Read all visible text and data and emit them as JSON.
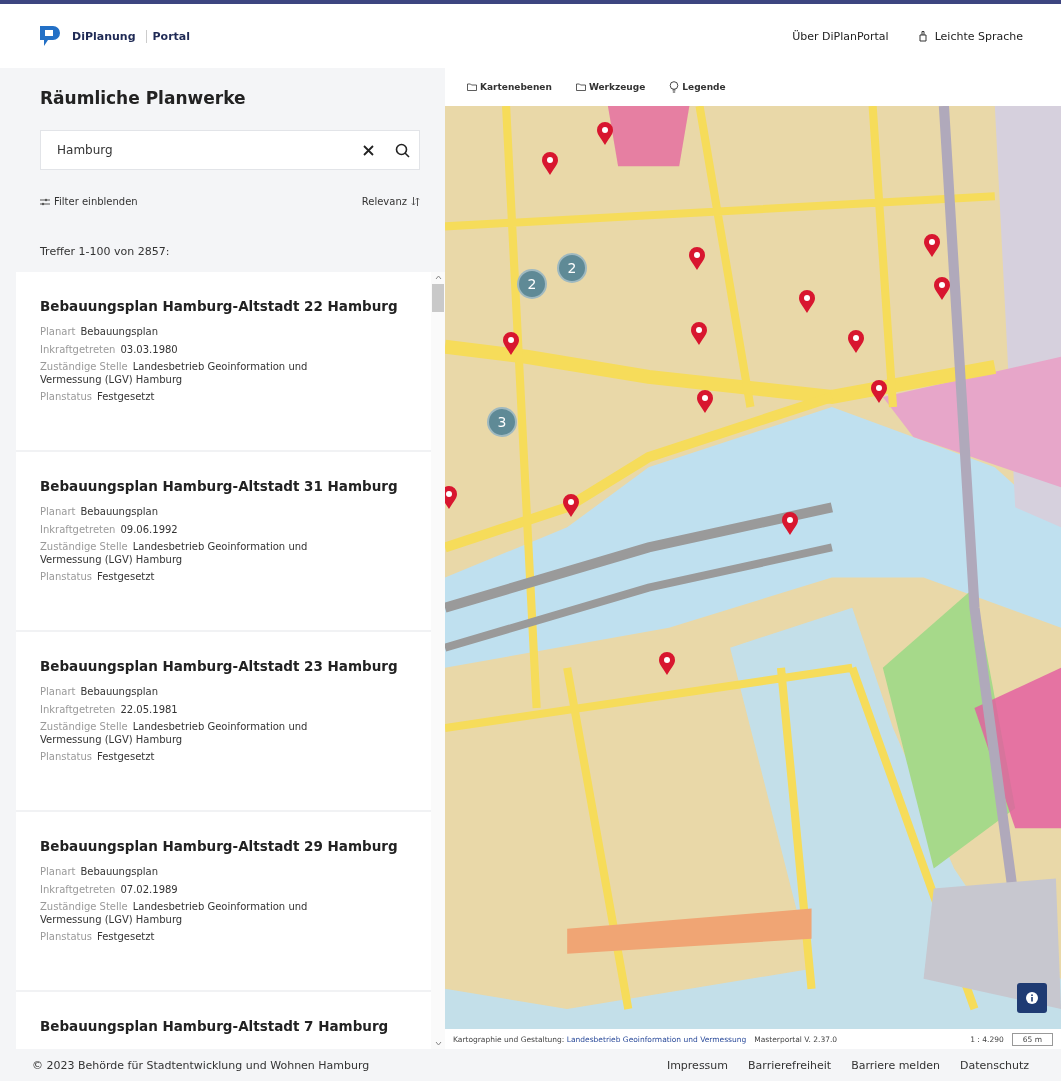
{
  "header": {
    "logo_text": "DiPlanung",
    "logo_subtext": "Portal",
    "links": [
      {
        "label": "Über DiPlanPortal",
        "kind": "text"
      },
      {
        "label": "Leichte Sprache",
        "kind": "icon"
      }
    ]
  },
  "sidebar": {
    "title": "Räumliche Planwerke",
    "search": {
      "value": "Hamburg"
    },
    "filter_label": "Filter einblenden",
    "sort_label": "Relevanz",
    "results_count": "Treffer 1-100 von 2857:",
    "results": [
      {
        "title": "Bebauungsplan Hamburg-Altstadt 22 Hamburg",
        "fields": [
          {
            "label": "Planart",
            "value": "Bebauungsplan"
          },
          {
            "label": "Inkraftgetreten",
            "value": "03.03.1980"
          },
          {
            "label": "Zuständige Stelle",
            "value": "Landesbetrieb Geoinformation und Vermessung (LGV) Hamburg"
          },
          {
            "label": "Planstatus",
            "value": "Festgesetzt"
          }
        ]
      },
      {
        "title": "Bebauungsplan Hamburg-Altstadt 31 Hamburg",
        "fields": [
          {
            "label": "Planart",
            "value": "Bebauungsplan"
          },
          {
            "label": "Inkraftgetreten",
            "value": "09.06.1992"
          },
          {
            "label": "Zuständige Stelle",
            "value": "Landesbetrieb Geoinformation und Vermessung (LGV) Hamburg"
          },
          {
            "label": "Planstatus",
            "value": "Festgesetzt"
          }
        ]
      },
      {
        "title": "Bebauungsplan Hamburg-Altstadt 23 Hamburg",
        "fields": [
          {
            "label": "Planart",
            "value": "Bebauungsplan"
          },
          {
            "label": "Inkraftgetreten",
            "value": "22.05.1981"
          },
          {
            "label": "Zuständige Stelle",
            "value": "Landesbetrieb Geoinformation und Vermessung (LGV) Hamburg"
          },
          {
            "label": "Planstatus",
            "value": "Festgesetzt"
          }
        ]
      },
      {
        "title": "Bebauungsplan Hamburg-Altstadt 29 Hamburg",
        "fields": [
          {
            "label": "Planart",
            "value": "Bebauungsplan"
          },
          {
            "label": "Inkraftgetreten",
            "value": "07.02.1989"
          },
          {
            "label": "Zuständige Stelle",
            "value": "Landesbetrieb Geoinformation und Vermessung (LGV) Hamburg"
          },
          {
            "label": "Planstatus",
            "value": "Festgesetzt"
          }
        ]
      },
      {
        "title": "Bebauungsplan Hamburg-Altstadt 7 Hamburg"
      }
    ]
  },
  "map": {
    "toolbar": [
      {
        "label": "Kartenebenen",
        "kind": "folder"
      },
      {
        "label": "Werkzeuge",
        "kind": "folder"
      },
      {
        "label": "Legende",
        "kind": "bulb"
      }
    ],
    "clusters": [
      "2",
      "2",
      "3"
    ],
    "attribution": {
      "credit_label": "Kartographie und Gestaltung:",
      "credit_link": "Landesbetrieb Geoinformation und Vermessung",
      "version": "Masterportal V. 2.37.0",
      "scale": "1 : 4.290",
      "scale_bar": "65 m"
    }
  },
  "footer": {
    "copyright": "© 2023 Behörde für Stadtentwicklung und Wohnen Hamburg",
    "links": [
      "Impressum",
      "Barrierefreiheit",
      "Barriere melden",
      "Datenschutz"
    ]
  }
}
